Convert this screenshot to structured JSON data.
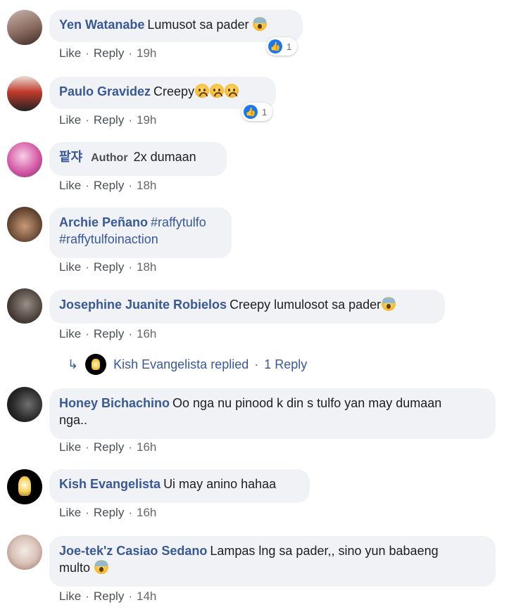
{
  "actions": {
    "like": "Like",
    "reply": "Reply",
    "sep": "·"
  },
  "comments": [
    {
      "name": "Yen Watanabe",
      "text": "Lumusot sa pader",
      "time": "19h",
      "reaction_count": "1",
      "emoji": "scream"
    },
    {
      "name": "Paulo Gravidez",
      "text": "Creepy",
      "time": "19h",
      "reaction_count": "1",
      "emoji": "worried"
    },
    {
      "name": "팥쟈",
      "badge": "Author",
      "text": "2x dumaan",
      "time": "18h"
    },
    {
      "name": "Archie Peñano",
      "text_line1": "#raffytulfo",
      "text_line2": "#raffytulfoinaction",
      "time": "18h"
    },
    {
      "name": "Josephine Juanite Robielos",
      "text": "Creepy lumulosot sa pader",
      "time": "16h",
      "emoji": "scream"
    },
    {
      "name": "Honey Bichachino",
      "text_line1": "Oo nga nu pinood k din s tulfo yan may dumaan",
      "text_line2": "nga..",
      "time": "16h"
    },
    {
      "name": "Kish Evangelista",
      "text": "Ui may anino hahaa",
      "time": "16h"
    },
    {
      "name": "Joe-tek'z Casiao Sedano",
      "text_line1": "Lampas lng sa pader,, sino yun babaeng",
      "text_line2": "multo",
      "time": "14h",
      "emoji": "scream"
    }
  ],
  "reply_summary": {
    "name": "Kish Evangelista",
    "replied": "replied",
    "count_label": "1 Reply"
  }
}
